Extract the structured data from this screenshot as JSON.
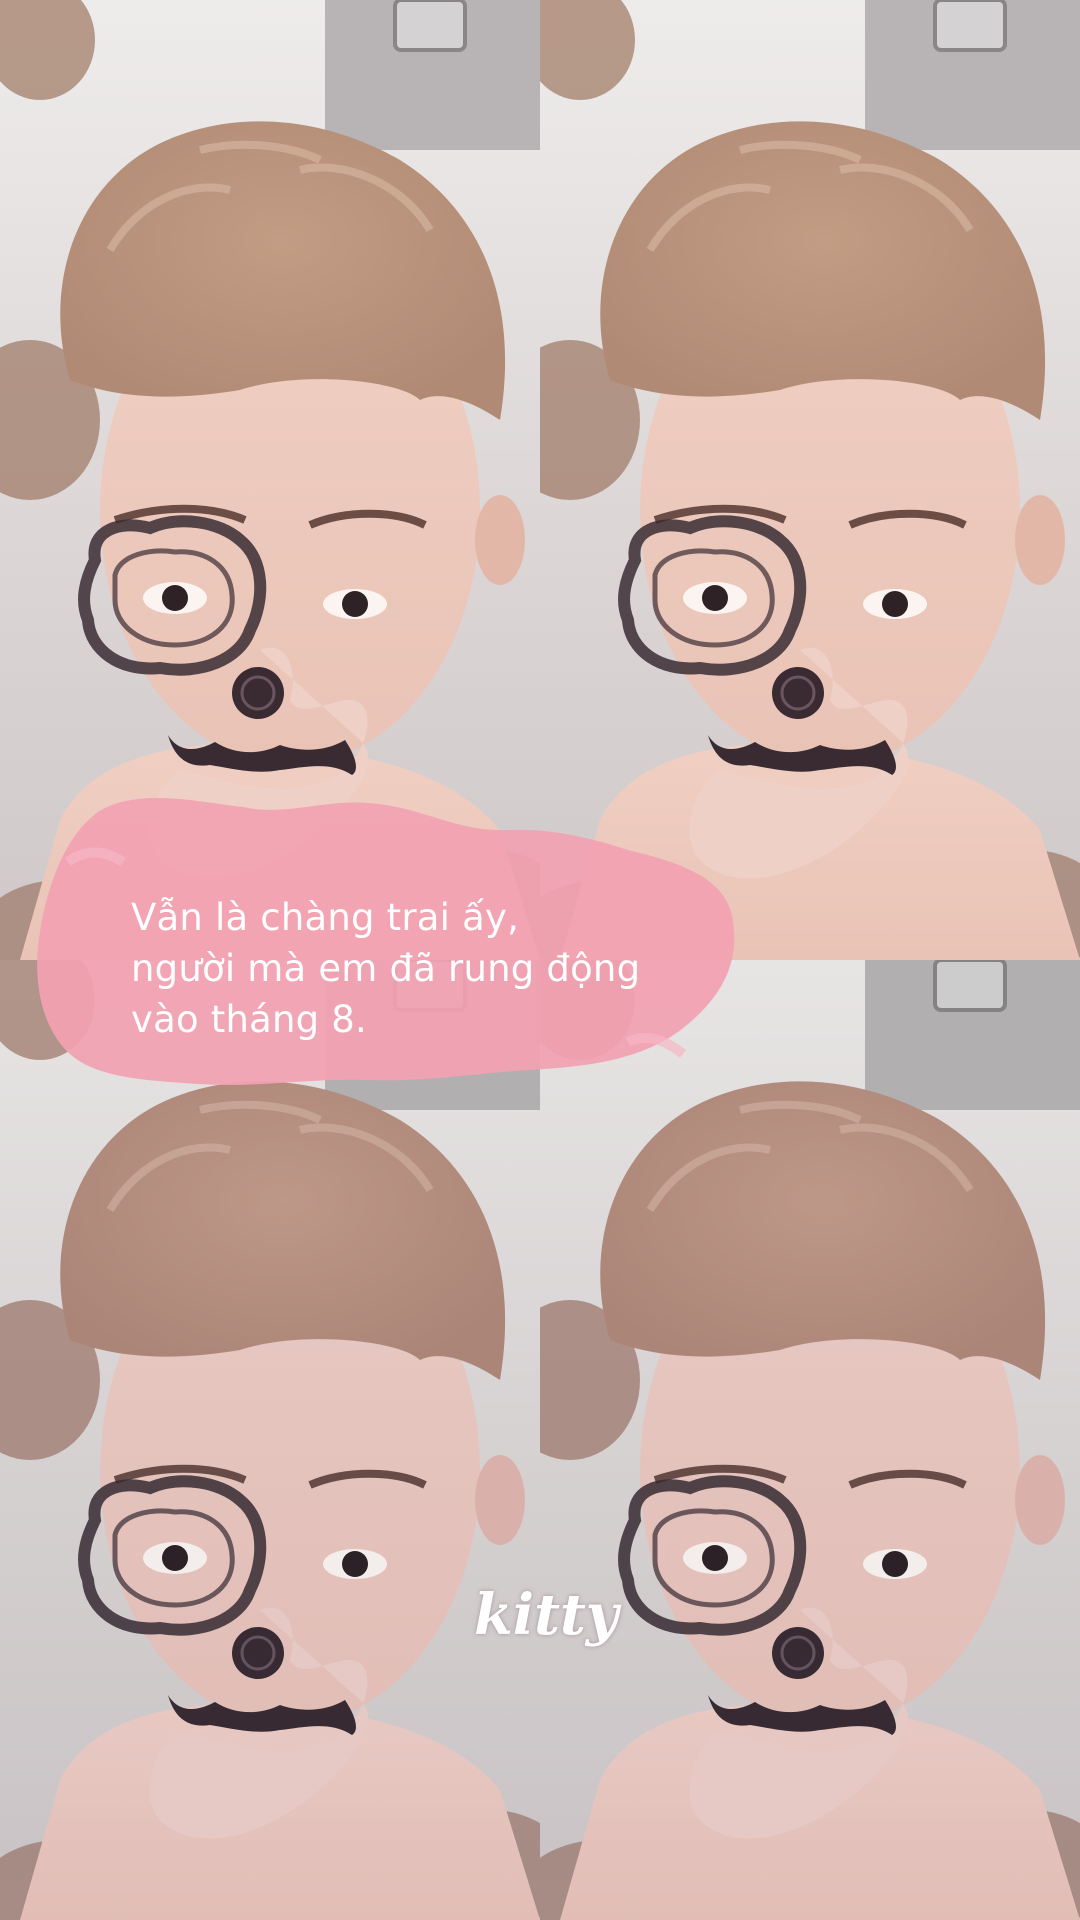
{
  "caption": {
    "lines": [
      "Vẫn là chàng trai ấy,",
      "người mà em đã rung động",
      "vào tháng 8."
    ]
  },
  "watermark": "kitty",
  "colors": {
    "caption_bubble": "#f2a1b2",
    "caption_text": "#ffffff",
    "hair": "#b08a74",
    "skin": "#e9c3b6",
    "sticker_ink": "#3a2b33"
  },
  "layout": {
    "grid": "2x2",
    "tiles": 4
  }
}
